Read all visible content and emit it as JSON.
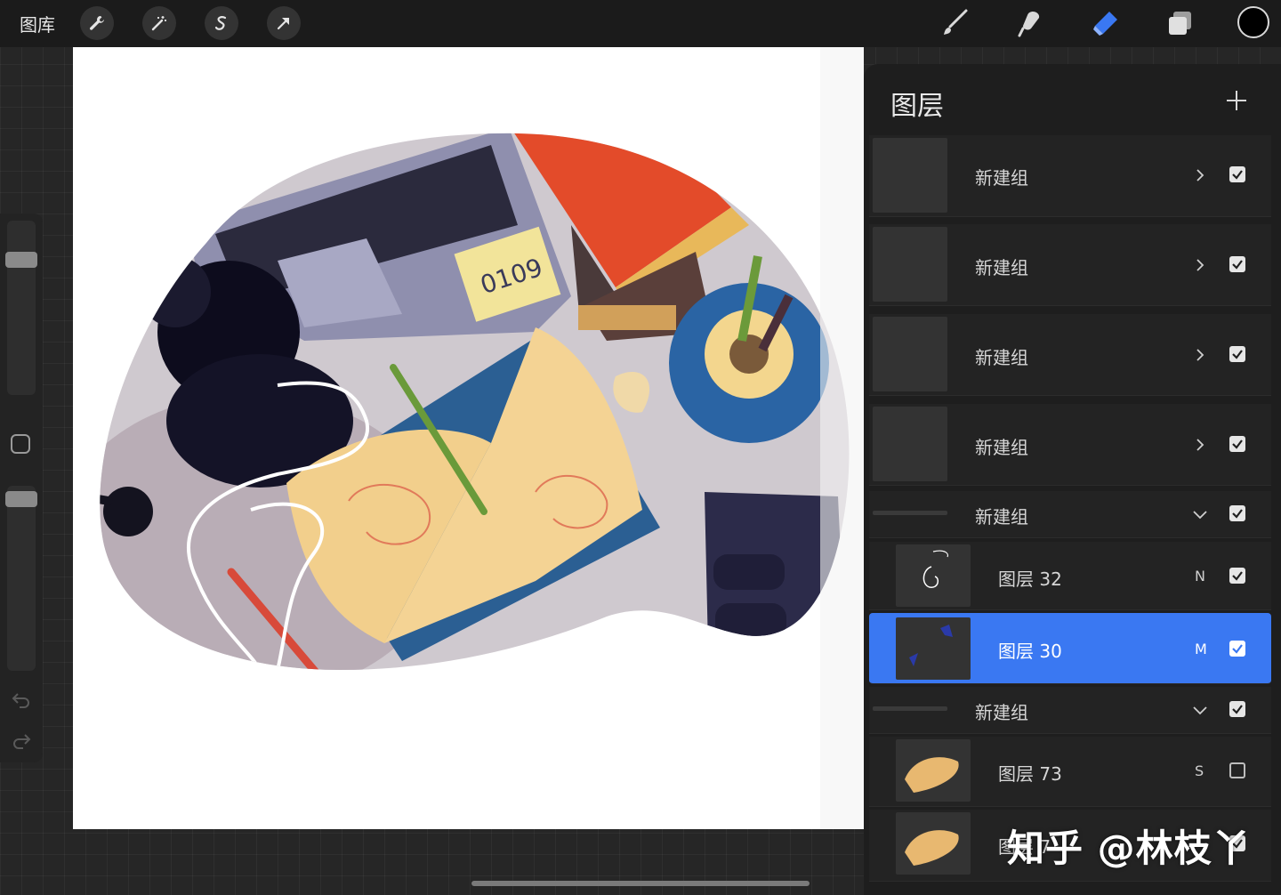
{
  "topbar": {
    "gallery_label": "图库",
    "left_tools": [
      "wrench-icon",
      "magic-wand-icon",
      "selection-icon",
      "transform-arrow-icon"
    ],
    "right_tools": [
      "brush-icon",
      "smudge-icon",
      "eraser-icon",
      "layers-icon"
    ],
    "active_tool": "eraser-icon",
    "accent_color": "#3a78f2",
    "current_color": "#000000"
  },
  "panel": {
    "title": "图层",
    "add_icon": "plus-icon",
    "rows": [
      {
        "kind": "group",
        "label": "新建组",
        "collapsed": true,
        "visible": true
      },
      {
        "kind": "group",
        "label": "新建组",
        "collapsed": true,
        "visible": true
      },
      {
        "kind": "group",
        "label": "新建组",
        "collapsed": true,
        "visible": true
      },
      {
        "kind": "group",
        "label": "新建组",
        "collapsed": true,
        "visible": true
      },
      {
        "kind": "group",
        "label": "新建组",
        "collapsed": false,
        "visible": true
      },
      {
        "kind": "layer",
        "label": "图层 32",
        "blend": "N",
        "visible": true,
        "selected": false
      },
      {
        "kind": "layer",
        "label": "图层 30",
        "blend": "M",
        "visible": true,
        "selected": true
      },
      {
        "kind": "group",
        "label": "新建组",
        "collapsed": false,
        "visible": true
      },
      {
        "kind": "layer",
        "label": "图层 73",
        "blend": "S",
        "visible": false,
        "selected": false
      },
      {
        "kind": "layer",
        "label": "图层 7",
        "blend": "",
        "visible": true,
        "selected": false
      }
    ]
  },
  "watermark": "知乎 @林枝丫",
  "canvas": {
    "note_text": "0109"
  }
}
